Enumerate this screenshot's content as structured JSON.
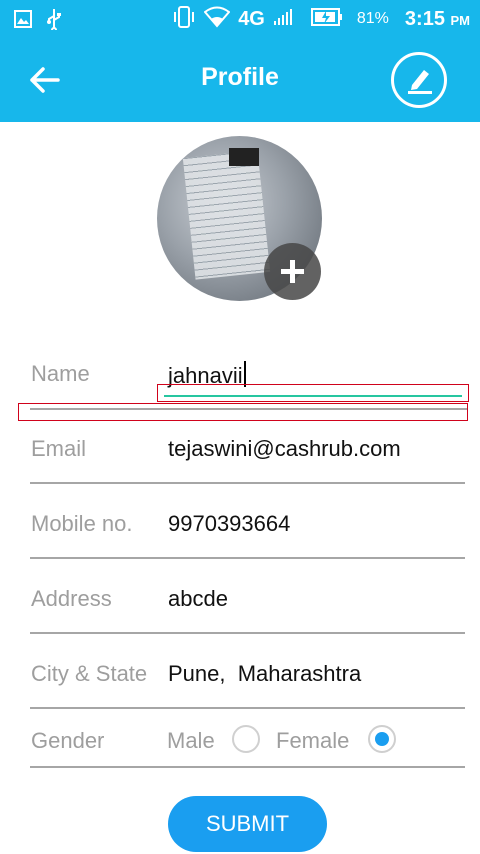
{
  "status_bar": {
    "network": "4G",
    "battery": "81%",
    "time": "3:15",
    "ampm": "PM"
  },
  "app_bar": {
    "title": "Profile"
  },
  "form": {
    "name_label": "Name",
    "name_value": "jahnavii",
    "email_label": "Email",
    "email_value": "tejaswini@cashrub.com",
    "mobile_label": "Mobile no.",
    "mobile_value": "9970393664",
    "address_label": "Address",
    "address_value": "abcde",
    "city_label": "City & State",
    "city_value": "Pune,  Maharashtra",
    "gender_label": "Gender",
    "gender_options": [
      "Male",
      "Female"
    ],
    "gender_selected": "Female"
  },
  "submit_label": "SUBMIT",
  "colors": {
    "app_bar": "#17b7eb",
    "accent": "#1a9ef0",
    "label": "#9e9e9e"
  }
}
